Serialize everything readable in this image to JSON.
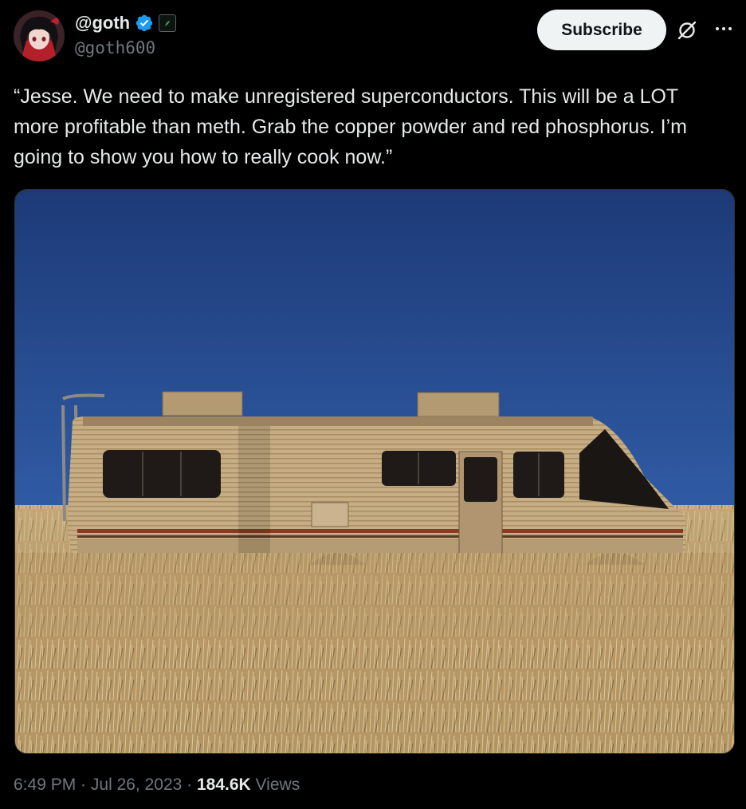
{
  "author": {
    "display_name": "@goth",
    "handle": "@goth600",
    "verified": true,
    "avatar_icon": "anime-avatar",
    "affiliate_icon": "affiliate-badge-icon"
  },
  "actions": {
    "subscribe_label": "Subscribe",
    "grok_icon": "grok-icon",
    "more_icon": "more-icon"
  },
  "tweet": {
    "text": "“Jesse. We need to make unregistered superconductors. This will be a LOT more profitable than meth. Grab the copper powder and red phosphorus. I’m going to show you how to really cook now.”"
  },
  "meta": {
    "time": "6:49 PM",
    "sep1": " · ",
    "date": "Jul 26, 2023",
    "sep2": " · ",
    "views_count": "184.6K",
    "views_label": " Views"
  },
  "colors": {
    "background": "#000000",
    "text": "#e7e9ea",
    "secondary": "#71767b",
    "verified_blue": "#1d9bf0",
    "subscribe_bg": "#eff3f4"
  }
}
